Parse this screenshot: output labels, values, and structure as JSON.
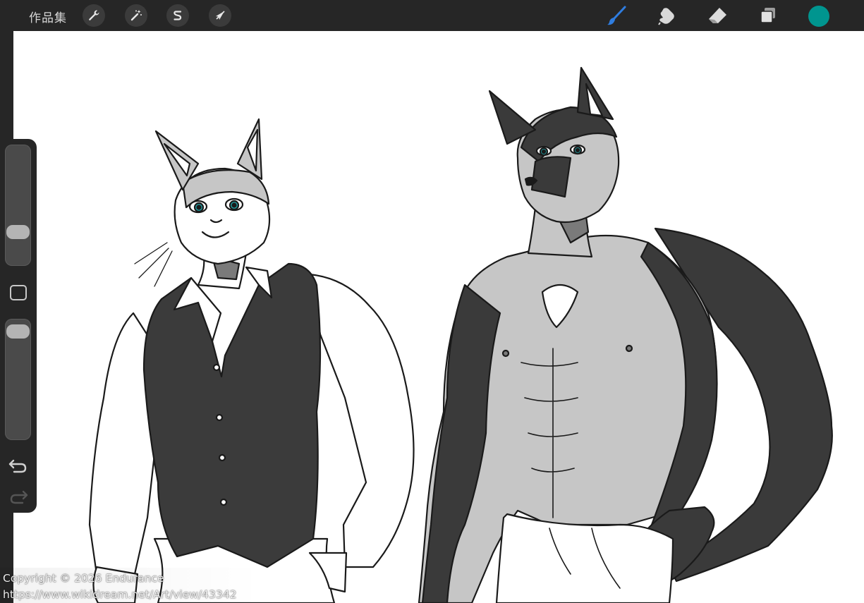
{
  "toolbar": {
    "gallery_label": "作品集",
    "left_tools": [
      {
        "name": "actions",
        "icon": "wrench-icon"
      },
      {
        "name": "adjustments",
        "icon": "magic-wand-icon"
      },
      {
        "name": "selection",
        "icon": "selection-s-icon"
      },
      {
        "name": "transform",
        "icon": "transform-arrow-icon"
      }
    ],
    "right_tools": [
      {
        "name": "brush",
        "icon": "brush-icon",
        "active": true
      },
      {
        "name": "smudge",
        "icon": "smudge-finger-icon",
        "active": false
      },
      {
        "name": "eraser",
        "icon": "eraser-icon",
        "active": false
      },
      {
        "name": "layers",
        "icon": "layers-icon",
        "active": false
      }
    ],
    "current_color": "#00958f",
    "active_tool_color": "#2f7de0"
  },
  "sidebar": {
    "brush_size_level": 0.24,
    "opacity_level": 0.96,
    "modify_icon": "square-modify-icon",
    "undo_icon": "undo-arrow-icon",
    "redo_icon": "redo-arrow-icon"
  },
  "watermark": {
    "line1": "Copyright © 2026 Endurance",
    "line2": "https://www.wikidream.net/Art/view/43342"
  },
  "colors": {
    "toolbar_bg": "#262626",
    "canvas_bg": "#ffffff",
    "vest": "#3b3b3b",
    "fur_light": "#c6c6c6",
    "fur_dark": "#3a3a3a",
    "eyes": "#1fa3a8"
  }
}
